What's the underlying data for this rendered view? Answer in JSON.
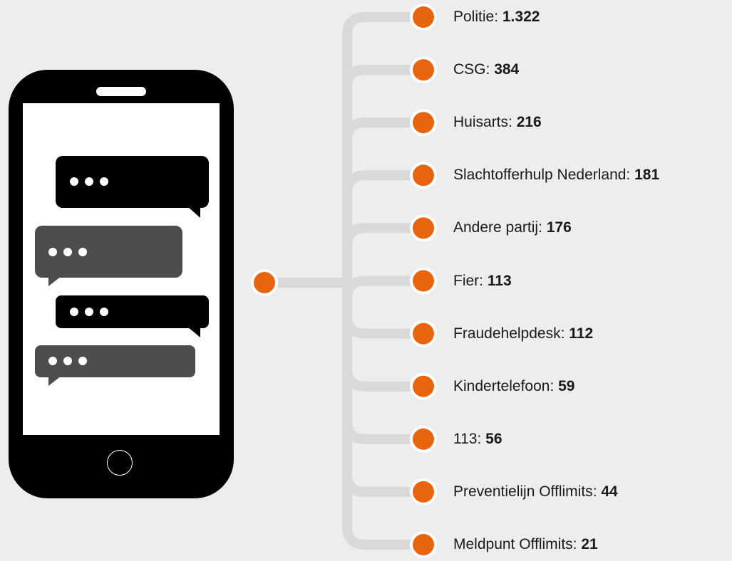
{
  "colors": {
    "background": "#ededed",
    "connector": "#d9d9d9",
    "node": "#e8640f",
    "node_ring": "#ffffff",
    "phone_body": "#000000",
    "phone_screen": "#ffffff",
    "bubble_dark": "#000000",
    "bubble_gray": "#4d4d4d"
  },
  "icons": {
    "phone": "smartphone-icon",
    "bubbles": "chat-bubble-icon",
    "home": "home-button-icon"
  },
  "branches": [
    {
      "name": "Politie",
      "value": "1.322"
    },
    {
      "name": "CSG",
      "value": "384"
    },
    {
      "name": "Huisarts",
      "value": "216"
    },
    {
      "name": "Slachtofferhulp Nederland",
      "value": "181"
    },
    {
      "name": "Andere partij",
      "value": "176"
    },
    {
      "name": "Fier",
      "value": "113"
    },
    {
      "name": "Fraudehelpdesk",
      "value": "112"
    },
    {
      "name": "Kindertelefoon",
      "value": "59"
    },
    {
      "name": "113",
      "value": "56"
    },
    {
      "name": "Preventielijn Offlimits",
      "value": "44"
    },
    {
      "name": "Meldpunt Offlimits",
      "value": "21"
    }
  ]
}
